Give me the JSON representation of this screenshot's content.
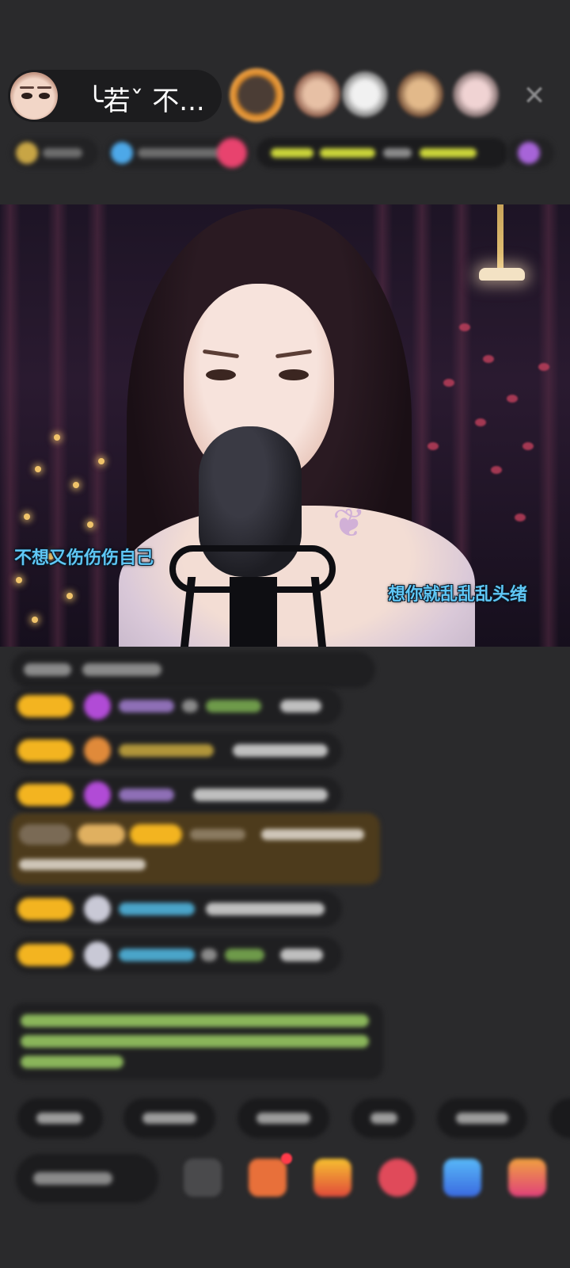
{
  "header": {
    "anchor_name": "╰若ˇ 不...",
    "close_icon": "close-icon"
  },
  "video": {
    "lyric_left": "不想又伤伤伤自己",
    "lyric_right": "想你就乱乱乱头绪"
  },
  "icons": {
    "close": "close-icon",
    "gift": "gift-icon",
    "emoji": "emoji-icon"
  },
  "colors": {
    "background": "#2a2a2c",
    "lyric_blue": "#5fc7f5",
    "badge_gold": "#f3b420",
    "highlight_brown": "#4d3b1c",
    "notif_red": "#ff3b4a"
  }
}
